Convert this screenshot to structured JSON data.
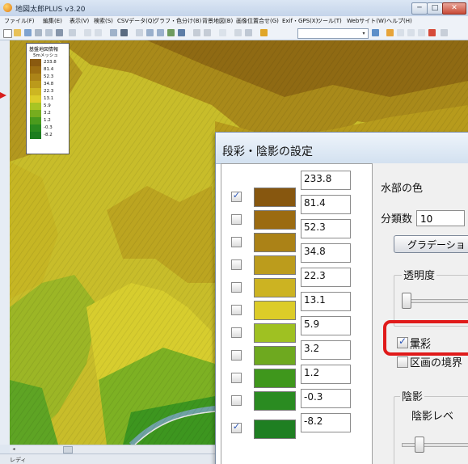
{
  "window": {
    "title": "地図太郎PLUS v3.20",
    "min_glyph": "─",
    "max_glyph": "□",
    "close_glyph": "✕"
  },
  "menu": [
    "ファイル(F)",
    "編集(E)",
    "表示(V)",
    "検索(S)",
    "CSVデータ(Q)",
    "グラフ・色分け(B)",
    "背景地図(B)",
    "画像位置合せ(G)",
    "Exif・GPS(X)",
    "ツール(T)",
    "Webサイト(W)",
    "ヘルプ(H)"
  ],
  "toolbar": {
    "combo_arrow": "▾"
  },
  "map": {
    "legend": {
      "title": "基盤地図情報",
      "subtitle": "5mメッシュ",
      "items": [
        {
          "label": "233.8",
          "color": "#8a5a10"
        },
        {
          "label": "81.4",
          "color": "#9c6e12"
        },
        {
          "label": "52.3",
          "color": "#ac8418"
        },
        {
          "label": "34.8",
          "color": "#bb9a1b"
        },
        {
          "label": "22.3",
          "color": "#cdb622"
        },
        {
          "label": "13.1",
          "color": "#dccd2a"
        },
        {
          "label": "5.9",
          "color": "#a8c424"
        },
        {
          "label": "3.2",
          "color": "#76ad1e"
        },
        {
          "label": "1.2",
          "color": "#4a9b1d"
        },
        {
          "label": "-0.3",
          "color": "#2a8a1f"
        },
        {
          "label": "-8.2",
          "color": "#1c7d1f"
        }
      ]
    }
  },
  "scroll": {
    "left_arrow": "◂"
  },
  "status": {
    "text": "レディ"
  },
  "dialog": {
    "title": "段彩・陰影の設定",
    "rows": [
      {
        "value": "233.8",
        "color": "#87570f",
        "checked": true
      },
      {
        "value": "81.4",
        "color": "#9b6b11",
        "checked": false
      },
      {
        "value": "52.3",
        "color": "#ab8217",
        "checked": false
      },
      {
        "value": "34.8",
        "color": "#bc9c1c",
        "checked": false
      },
      {
        "value": "22.3",
        "color": "#ccb322",
        "checked": false
      },
      {
        "value": "13.1",
        "color": "#dccc28",
        "checked": false
      },
      {
        "value": "5.9",
        "color": "#9fc122",
        "checked": false
      },
      {
        "value": "3.2",
        "color": "#6ea91f",
        "checked": false
      },
      {
        "value": "1.2",
        "color": "#3f971c",
        "checked": false
      },
      {
        "value": "-0.3",
        "color": "#2a8b21",
        "checked": false
      },
      {
        "value": "-8.2",
        "color": "#1f7f22",
        "checked": true
      }
    ],
    "check_glyph": "✓",
    "water_label": "水部の色",
    "water_color": "#a9cdf2",
    "class_label": "分類数",
    "class_value": "10",
    "gradient_button": "グラデーショ",
    "transparency_label": "透明度",
    "nimbus_label": "暈彩",
    "nimbus_checked": true,
    "boundary_label": "区画の境界",
    "boundary_checked": false,
    "shade_group_label": "陰影",
    "shade_level_label": "陰影レベ"
  }
}
